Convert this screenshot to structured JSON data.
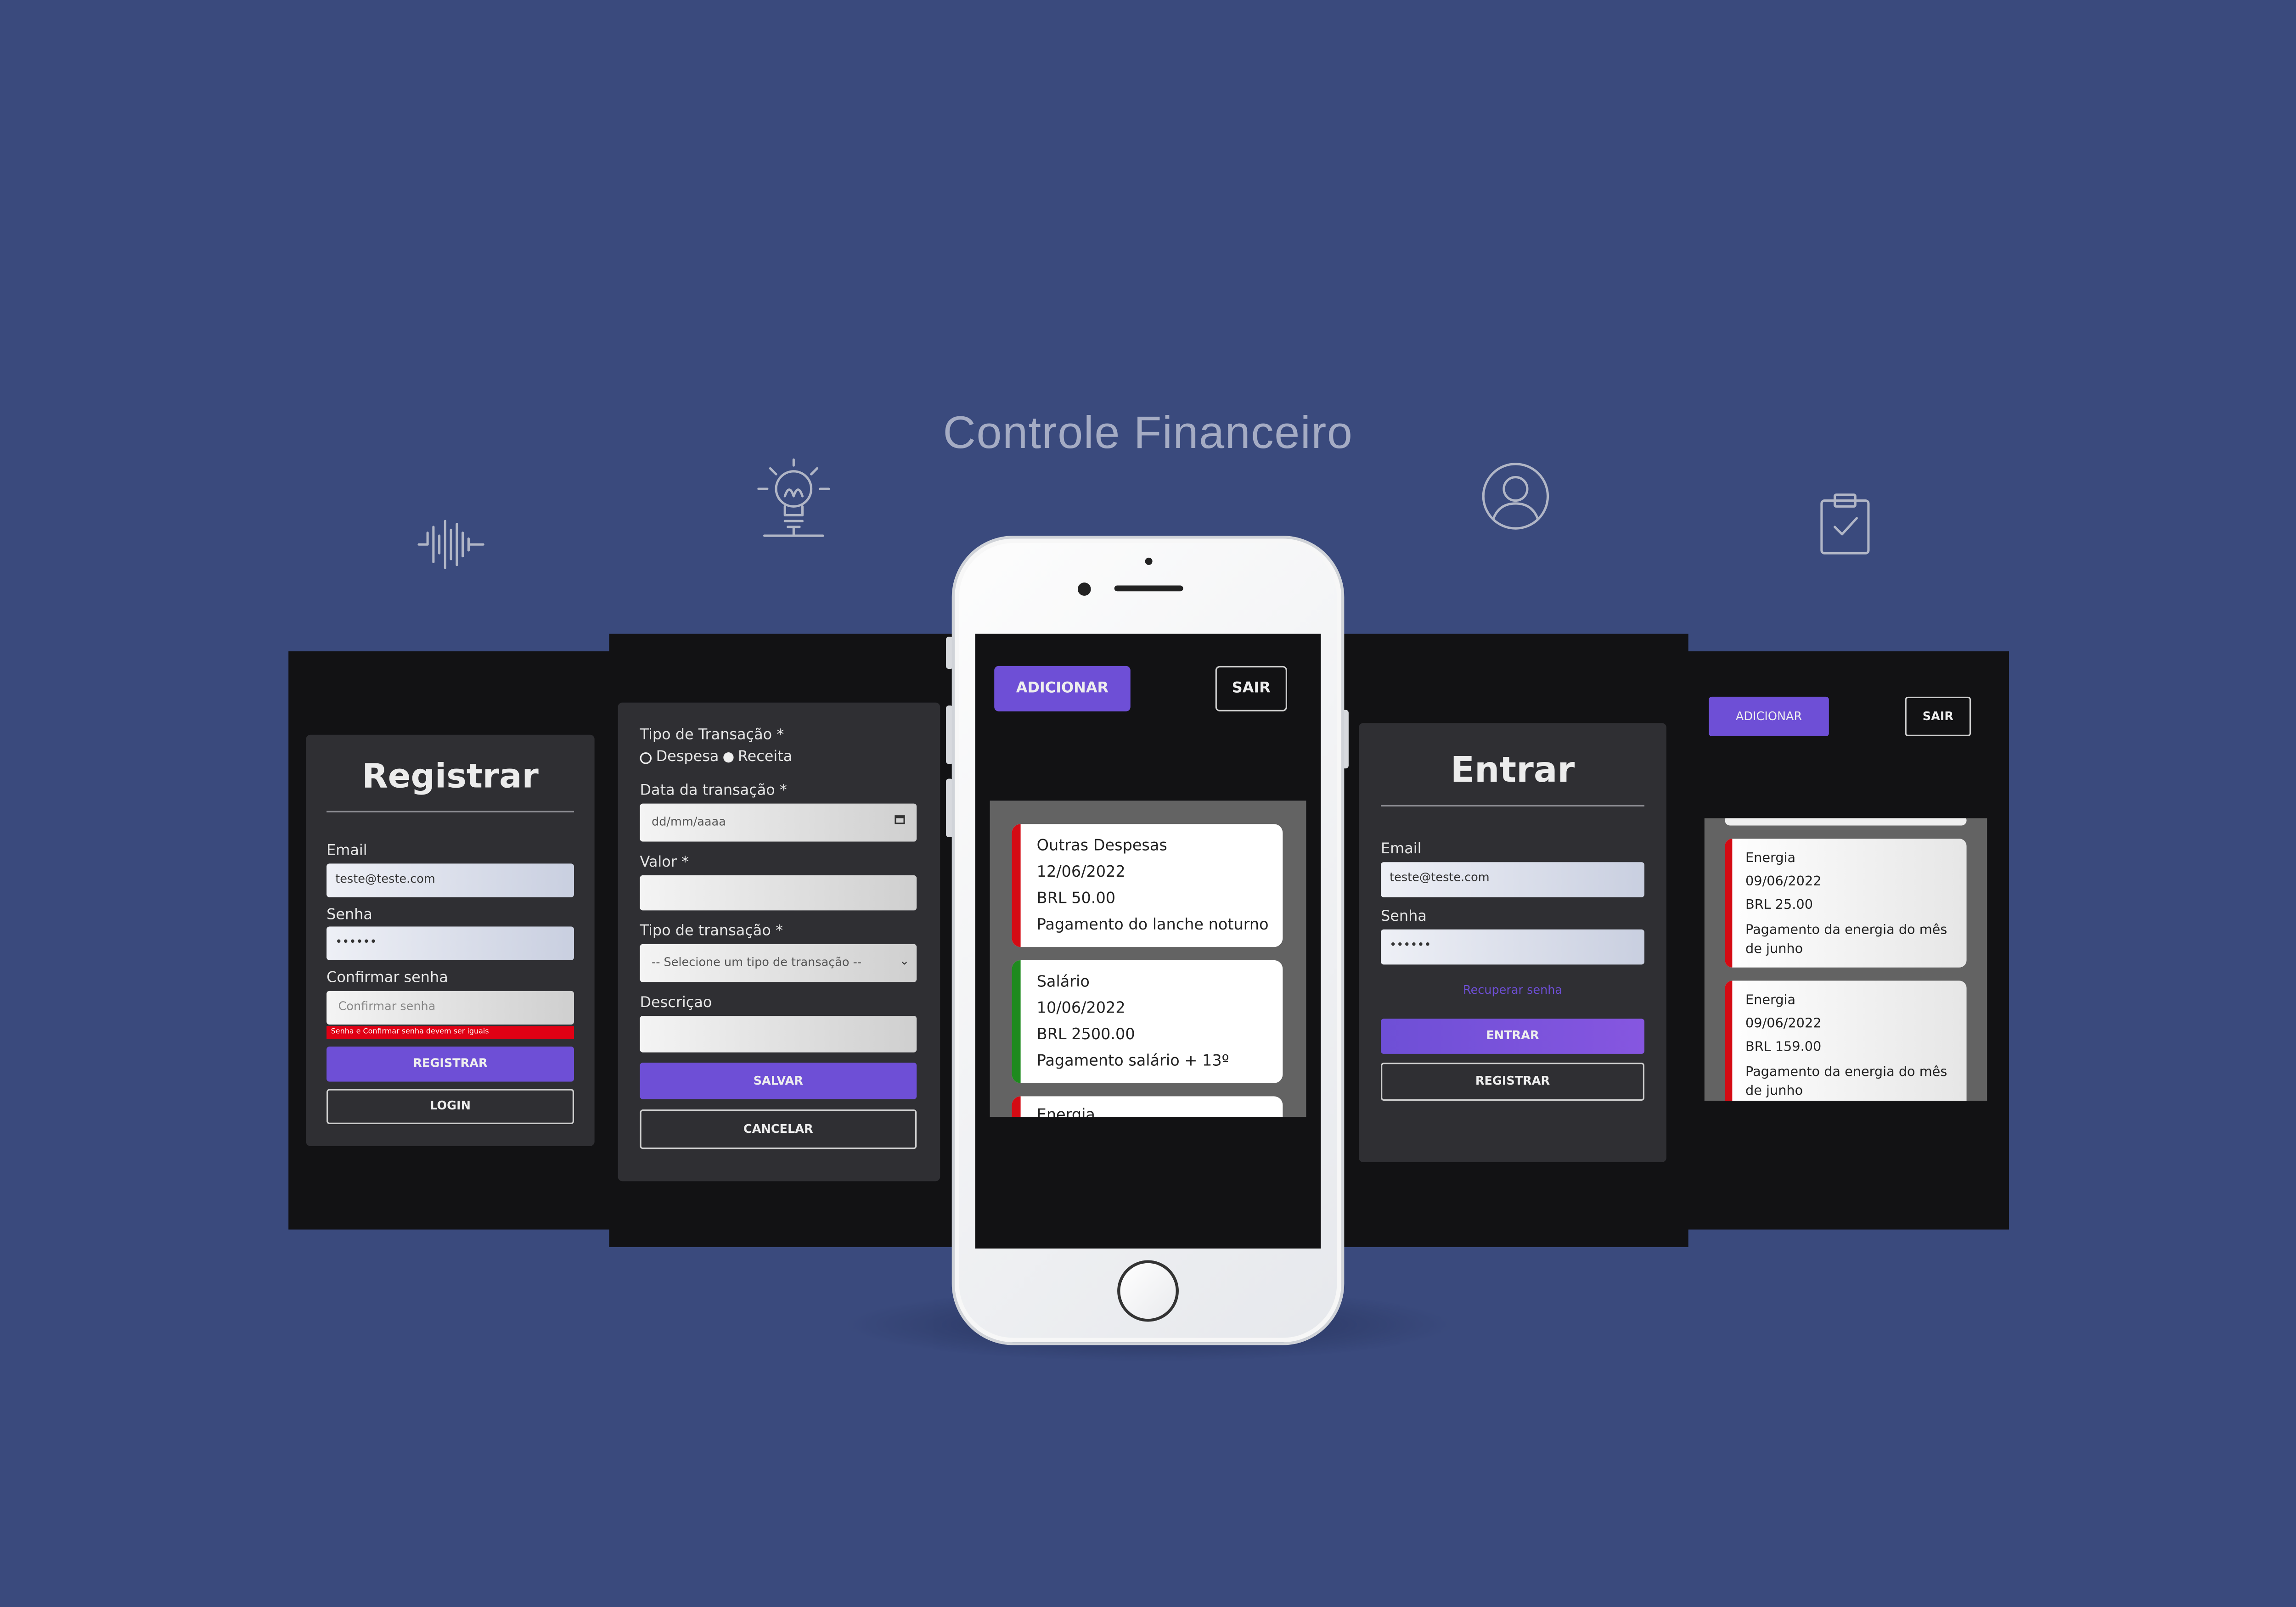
{
  "app_title": "Controle Financeiro",
  "colors": {
    "background": "#3a4a7d",
    "accent": "#6e4fd6",
    "despesa": "#d40b14",
    "receita": "#1e8a1e"
  },
  "icons": [
    "sound-wave-icon",
    "lightbulb-icon",
    "user-icon",
    "clipboard-check-icon"
  ],
  "register_screen": {
    "title": "Registrar",
    "email_label": "Email",
    "email_value": "teste@teste.com",
    "senha_label": "Senha",
    "senha_value": "••••••",
    "confirm_label": "Confirmar senha",
    "confirm_placeholder": "Confirmar senha",
    "error_message": "Senha e Confirmar senha devem ser iguais",
    "register_button": "REGISTRAR",
    "login_button": "LOGIN"
  },
  "transaction_form": {
    "tipo_label": "Tipo de Transação *",
    "radio_despesa": "Despesa",
    "radio_receita": "Receita",
    "data_label": "Data da transação *",
    "data_placeholder": "dd/mm/aaaa",
    "valor_label": "Valor *",
    "tipo2_label": "Tipo de transação *",
    "select_value": "-- Selecione um tipo de transação --",
    "descricao_label": "Descriçao",
    "save_button": "SALVAR",
    "cancel_button": "CANCELAR"
  },
  "phone_screen": {
    "add_button": "ADICIONAR",
    "exit_button": "SAIR",
    "transactions": [
      {
        "category": "Outras Despesas",
        "date": "12/06/2022",
        "amount": "BRL 50.00",
        "description": "Pagamento do lanche noturno",
        "type": "despesa"
      },
      {
        "category": "Salário",
        "date": "10/06/2022",
        "amount": "BRL 2500.00",
        "description": "Pagamento salário + 13º",
        "type": "receita"
      },
      {
        "category": "Energia",
        "type": "despesa"
      }
    ]
  },
  "login_screen": {
    "title": "Entrar",
    "email_label": "Email",
    "email_value": "teste@teste.com",
    "senha_label": "Senha",
    "senha_value": "••••••",
    "recover_link": "Recuperar senha",
    "enter_button": "ENTRAR",
    "register_button": "REGISTRAR"
  },
  "list_screen": {
    "add_button": "ADICIONAR",
    "exit_button": "SAIR",
    "transactions": [
      {
        "category": "Energia",
        "date": "09/06/2022",
        "amount": "BRL 25.00",
        "description": "Pagamento da energia do mês de junho",
        "type": "despesa"
      },
      {
        "category": "Energia",
        "date": "09/06/2022",
        "amount": "BRL 159.00",
        "description": "Pagamento da energia do mês de junho",
        "type": "despesa"
      }
    ]
  }
}
